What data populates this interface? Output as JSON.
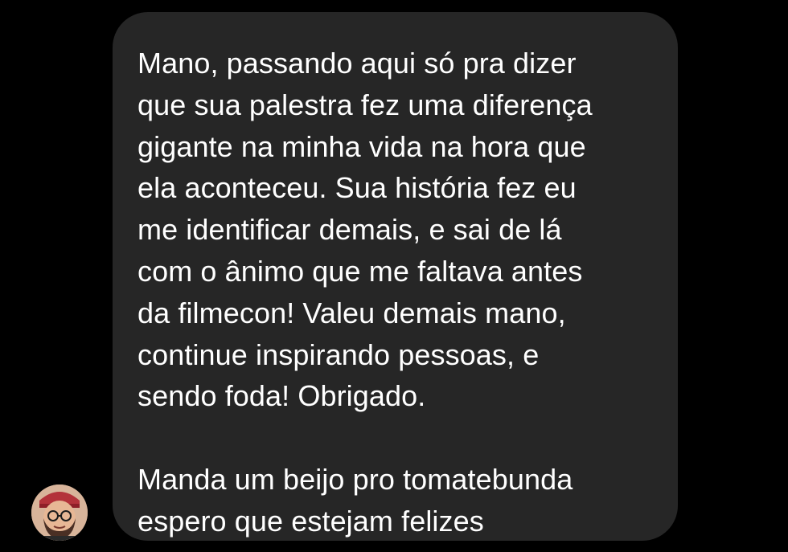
{
  "theme": {
    "background": "#000000",
    "bubble_color": "#262626",
    "text_color": "#ffffff"
  },
  "message": {
    "paragraphs": [
      "Mano, passando aqui só pra dizer\nque sua palestra fez uma diferença\ngigante na minha vida na hora que\nela aconteceu. Sua história fez eu\nme identificar demais, e sai de lá\ncom o ânimo que me faltava antes\nda filmecon! Valeu demais mano,\ncontinue inspirando pessoas, e\nsendo foda! Obrigado.",
      "Manda um beijo pro tomatebunda\nespero que estejam felizes"
    ]
  },
  "sender": {
    "avatar_icon": "user-avatar-photo"
  }
}
